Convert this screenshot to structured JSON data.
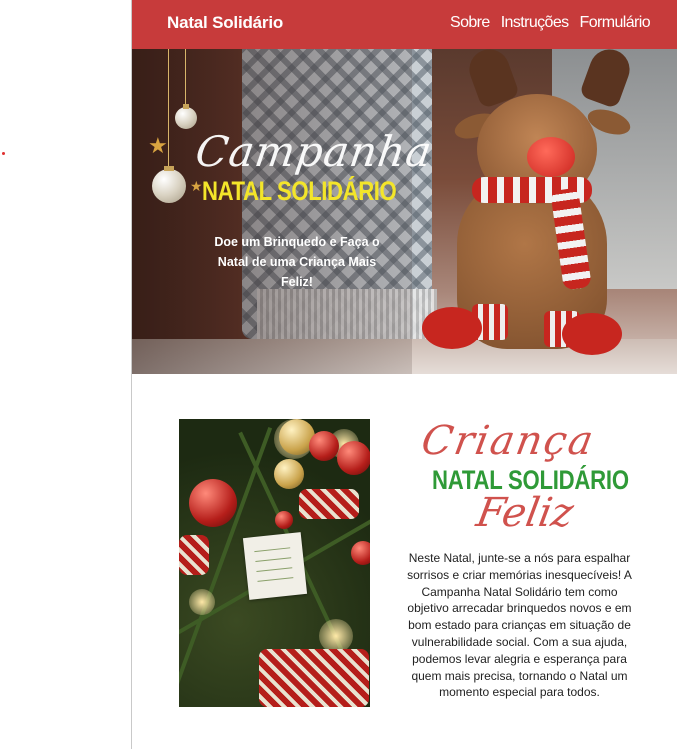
{
  "nav": {
    "brand": "Natal Solidário",
    "links": [
      "Sobre",
      "Instruções",
      "Formulário"
    ]
  },
  "hero": {
    "script_title": "Campanha",
    "title": "NATAL SOLIDÁRIO",
    "subtitle": "Doe um Brinquedo e Faça o Natal de uma Criança Mais Feliz!"
  },
  "about": {
    "script_top": "Criança",
    "title": "NATAL SOLIDÁRIO",
    "script_bottom": "Feliz",
    "text": "Neste Natal, junte-se a nós para espalhar sorrisos e criar memórias inesquecíveis! A Campanha Natal Solidário tem como objetivo arrecadar brinquedos novos e em bom estado para crianças em situação de vulnerabilidade social. Com a sua ajuda, podemos levar alegria e esperança para quem mais precisa, tornando o Natal um momento especial para todos."
  },
  "colors": {
    "nav_bg": "#c73b3b",
    "hero_title": "#f3e52a",
    "section_title": "#2f9a37",
    "script_red": "#c8342f"
  }
}
